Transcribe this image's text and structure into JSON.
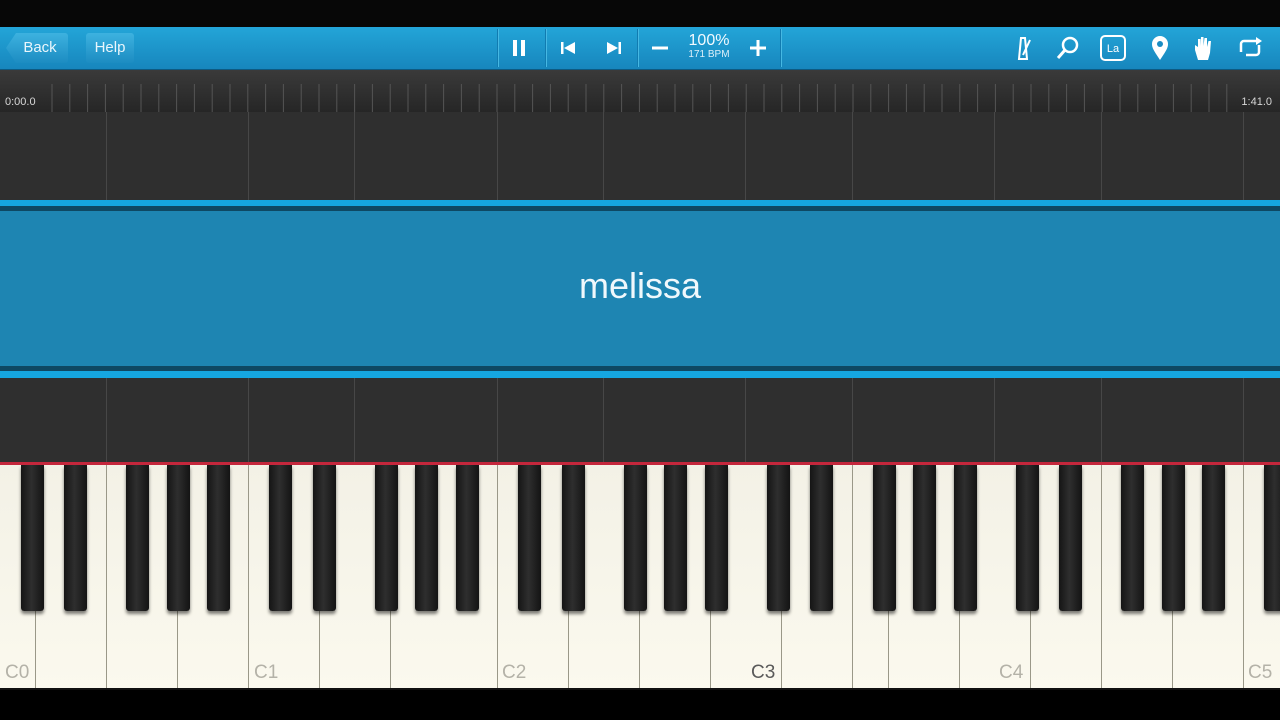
{
  "toolbar": {
    "back_label": "Back",
    "help_label": "Help",
    "speed_percent": "100%",
    "bpm": "171 BPM"
  },
  "timeline": {
    "start_time": "0:00.0",
    "end_time": "1:41.0"
  },
  "song": {
    "title": "melissa"
  },
  "keyboard": {
    "octave_labels": [
      "C0",
      "C1",
      "C2",
      "C3",
      "C4",
      "C5"
    ],
    "highlighted_label": "C3"
  },
  "colors": {
    "toolbar": "#1a93c9",
    "title_band": "#1e85b2",
    "playhead": "#c4273c"
  },
  "icons": [
    "pause-icon",
    "skip-back-icon",
    "skip-forward-icon",
    "minus-icon",
    "plus-icon",
    "metronome-icon",
    "magnifier-icon",
    "key-labels-icon",
    "location-pin-icon",
    "hand-icon",
    "loop-icon"
  ]
}
